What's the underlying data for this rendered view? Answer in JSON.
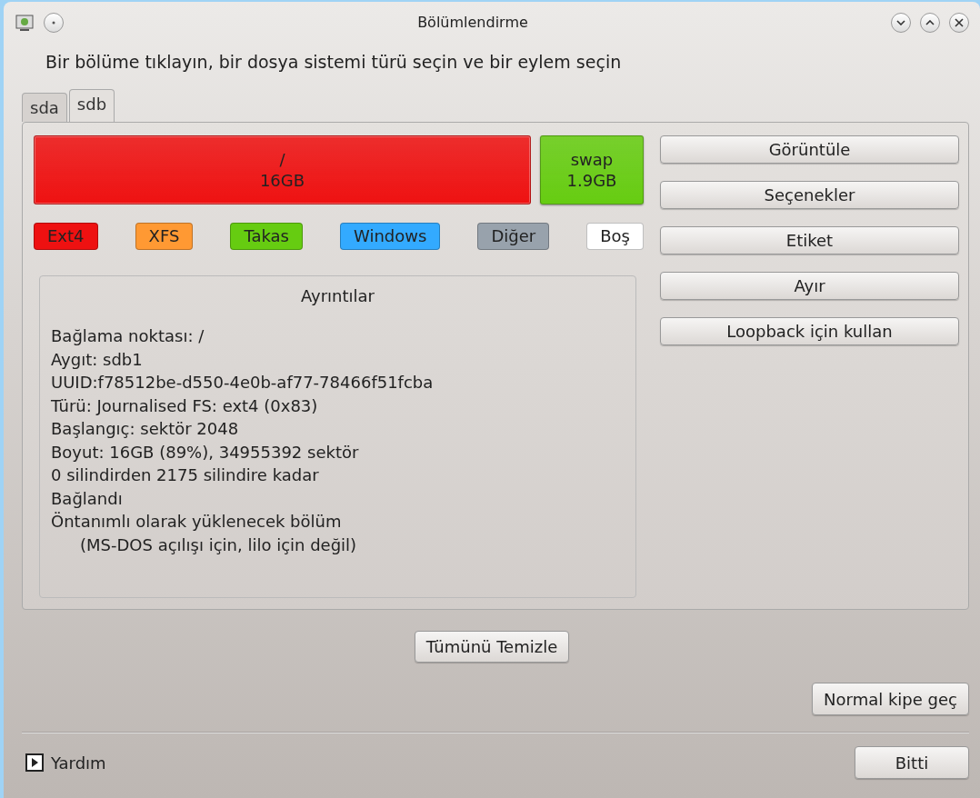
{
  "window": {
    "title": "Bölümlendirme"
  },
  "instruction": "Bir bölüme tıklayın, bir dosya sistemi türü seçin ve bir eylem seçin",
  "tabs": [
    {
      "label": "sda",
      "selected": false
    },
    {
      "label": "sdb",
      "selected": true
    }
  ],
  "partitions": [
    {
      "name": "/",
      "size": "16GB",
      "color": "#ee1111",
      "selected": true
    },
    {
      "name": "swap",
      "size": "1.9GB",
      "color": "#66cc11",
      "selected": false
    }
  ],
  "legend": [
    {
      "label": "Ext4",
      "color": "#ee1111"
    },
    {
      "label": "XFS",
      "color": "#ff9933"
    },
    {
      "label": "Takas",
      "color": "#66cc11"
    },
    {
      "label": "Windows",
      "color": "#33aaff"
    },
    {
      "label": "Diğer",
      "color": "#98a2ac"
    },
    {
      "label": "Boş",
      "color": "#ffffff"
    }
  ],
  "details": {
    "title": "Ayrıntılar",
    "lines": [
      {
        "text": "Bağlama noktası: /",
        "indented": false
      },
      {
        "text": "Aygıt: sdb1",
        "indented": false
      },
      {
        "text": "UUID:f78512be-d550-4e0b-af77-78466f51fcba",
        "indented": false
      },
      {
        "text": "Türü: Journalised FS: ext4 (0x83)",
        "indented": false
      },
      {
        "text": "Başlangıç: sektör 2048",
        "indented": false
      },
      {
        "text": "Boyut: 16GB (89%), 34955392 sektör",
        "indented": false
      },
      {
        "text": "0 silindirden 2175 silindire kadar",
        "indented": false
      },
      {
        "text": "Bağlandı",
        "indented": false
      },
      {
        "text": "Öntanımlı olarak yüklenecek bölüm",
        "indented": false
      },
      {
        "text": "(MS-DOS açılışı için, lilo için değil)",
        "indented": true
      }
    ]
  },
  "actions": [
    "Görüntüle",
    "Seçenekler",
    "Etiket",
    "Ayır",
    "Loopback için kullan"
  ],
  "clear_button": "Tümünü Temizle",
  "mode_button": "Normal kipe geç",
  "help": {
    "label": "Yardım",
    "expanded": false
  },
  "done_button": "Bitti"
}
